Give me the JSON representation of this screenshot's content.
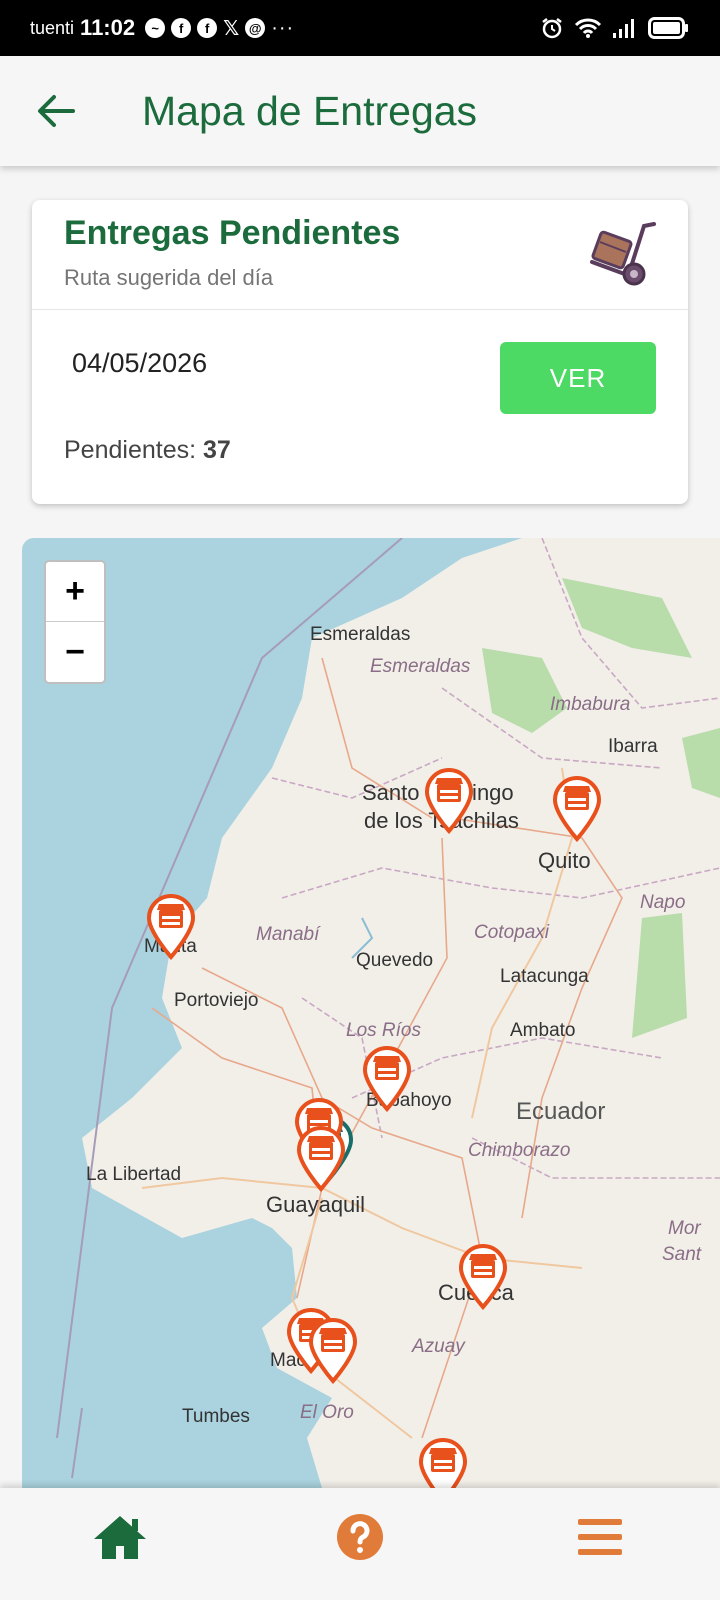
{
  "status_bar": {
    "carrier": "tuenti",
    "time": "11:02",
    "more": "···"
  },
  "header": {
    "title": "Mapa de Entregas"
  },
  "card": {
    "title": "Entregas Pendientes",
    "subtitle": "Ruta sugerida del día",
    "date": "04/05/2026",
    "ver_label": "VER",
    "pending_label": "Pendientes:",
    "pending_count": "37"
  },
  "map": {
    "zoom_in": "+",
    "zoom_out": "−",
    "labels": {
      "esmeraldas_city": "Esmeraldas",
      "esmeraldas_prov": "Esmeraldas",
      "imbabura": "Imbabura",
      "ibarra": "Ibarra",
      "santo_domingo_1": "Santo Domingo",
      "santo_domingo_2": "de los Tsáchilas",
      "quito": "Quito",
      "napo": "Napo",
      "manta": "Manta",
      "manabi": "Manabí",
      "cotopaxi": "Cotopaxi",
      "quevedo": "Quevedo",
      "latacunga": "Latacunga",
      "portoviejo": "Portoviejo",
      "ambato": "Ambato",
      "los_rios": "Los Ríos",
      "babahoyo": "Babahoyo",
      "ecuador": "Ecuador",
      "chimborazo": "Chimborazo",
      "la_libertad": "La Libertad",
      "guayaquil": "Guayaquil",
      "morona_1": "Mor",
      "morona_2": "Sant",
      "cuenca": "Cuenca",
      "azuay": "Azuay",
      "machala": "Machala",
      "tumbes": "Tumbes",
      "el_oro": "El Oro"
    },
    "pin_color": "#e8501c",
    "pin_alt_color": "#1a6e6a"
  },
  "bottom_nav": {
    "active_color": "#1b6b3c",
    "accent_color": "#e07b39"
  }
}
